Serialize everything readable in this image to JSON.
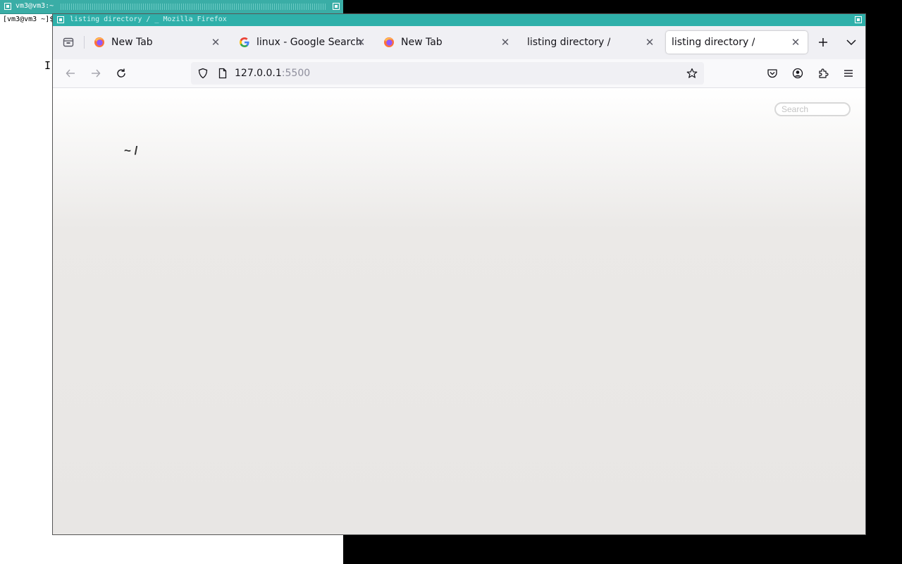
{
  "terminal": {
    "title": "vm3@vm3:~",
    "prompt": "[vm3@vm3 ~]$"
  },
  "window": {
    "title": "listing directory / _ Mozilla Firefox"
  },
  "tabs": [
    {
      "label": "New Tab",
      "favicon": "firefox-icon",
      "active": false
    },
    {
      "label": "linux - Google Search",
      "favicon": "google-icon",
      "active": false
    },
    {
      "label": "New Tab",
      "favicon": "firefox-icon",
      "active": false
    },
    {
      "label": "listing directory /",
      "favicon": "",
      "active": false
    },
    {
      "label": "listing directory /",
      "favicon": "",
      "active": true
    }
  ],
  "urlbar": {
    "host": "127.0.0.1",
    "port": ":5500"
  },
  "page": {
    "search_placeholder": "Search",
    "breadcrumb": "~ /"
  },
  "colors": {
    "wm_titlebar": "#2fb0aa",
    "tab_strip": "#f0f0f4",
    "page_background": "#e8e6e4"
  }
}
